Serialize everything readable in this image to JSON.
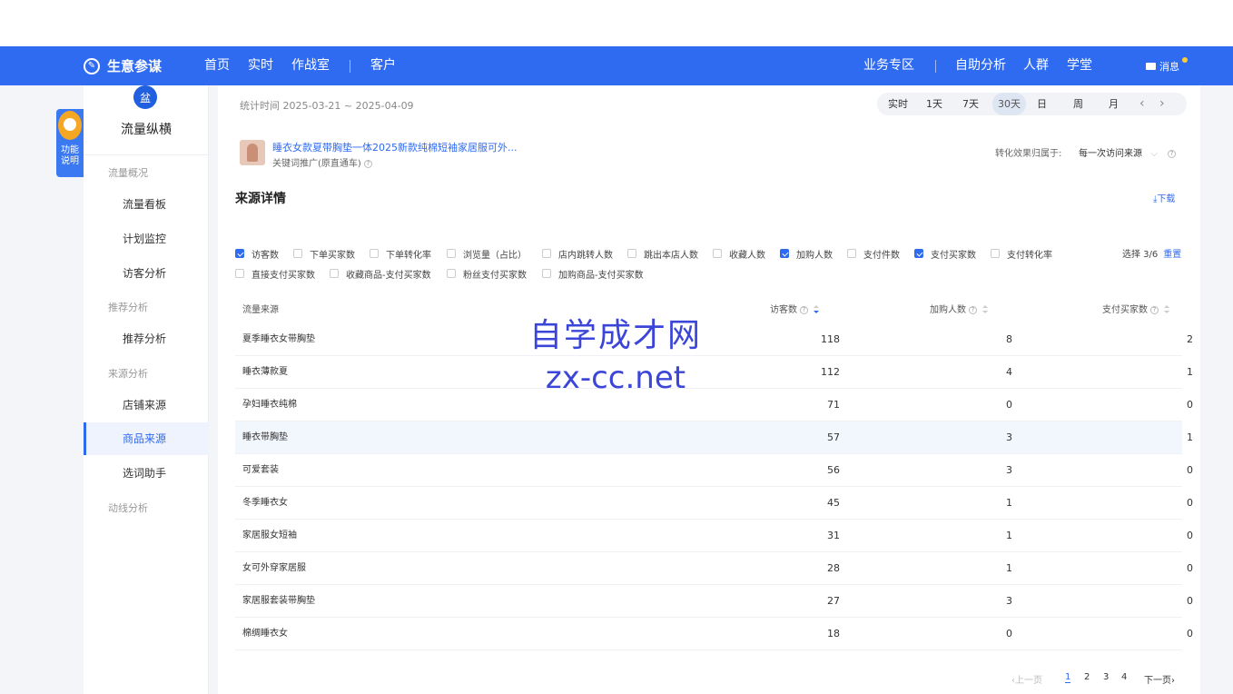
{
  "topnav": {
    "brand": "生意参谋",
    "left_items": [
      "首页",
      "实时",
      "作战室",
      "客户"
    ],
    "right_items": [
      "业务专区",
      "自助分析",
      "人群",
      "学堂"
    ],
    "messages": "消息"
  },
  "helper": {
    "label": "功能说明"
  },
  "sidebar": {
    "icon_char": "盆",
    "title": "流量纵横",
    "groups": [
      {
        "label": "流量概况",
        "items": [
          "流量看板",
          "计划监控",
          "访客分析"
        ]
      },
      {
        "label": "推荐分析",
        "items": [
          "推荐分析"
        ]
      },
      {
        "label": "来源分析",
        "items": [
          "店铺来源",
          "商品来源",
          "选词助手"
        ]
      },
      {
        "label": "动线分析",
        "items": []
      }
    ],
    "active_item": "商品来源"
  },
  "header": {
    "stat_time": "统计时间 2025-03-21 ~ 2025-04-09",
    "periods": [
      "实时",
      "1天",
      "7天",
      "30天",
      "日",
      "周",
      "月"
    ],
    "active_period": "30天",
    "prev": "‹",
    "next": "›"
  },
  "product": {
    "title": "睡衣女款夏带胸垫一体2025新款纯棉短袖家居服可外...",
    "subtitle": "关键词推广(原直通车)"
  },
  "attribution": {
    "label": "转化效果归属于:",
    "value": "每一次访问来源"
  },
  "section": {
    "title": "来源详情",
    "download": "下载"
  },
  "metrics": {
    "row1": [
      {
        "label": "访客数",
        "checked": true
      },
      {
        "label": "下单买家数",
        "checked": false
      },
      {
        "label": "下单转化率",
        "checked": false
      },
      {
        "label": "浏览量（占比）",
        "checked": false
      },
      {
        "label": "店内跳转人数",
        "checked": false
      },
      {
        "label": "跳出本店人数",
        "checked": false
      },
      {
        "label": "收藏人数",
        "checked": false
      },
      {
        "label": "加购人数",
        "checked": true
      },
      {
        "label": "支付件数",
        "checked": false
      },
      {
        "label": "支付买家数",
        "checked": true
      },
      {
        "label": "支付转化率",
        "checked": false
      }
    ],
    "row2": [
      {
        "label": "直接支付买家数",
        "checked": false
      },
      {
        "label": "收藏商品-支付买家数",
        "checked": false
      },
      {
        "label": "粉丝支付买家数",
        "checked": false
      },
      {
        "label": "加购商品-支付买家数",
        "checked": false
      }
    ],
    "selected": "选择 3/6",
    "reset": "重置"
  },
  "table": {
    "headers": [
      "流量来源",
      "访客数",
      "加购人数",
      "支付买家数"
    ],
    "rows": [
      {
        "source": "夏季睡衣女带胸垫",
        "visitors": "118",
        "cart": "8",
        "buyers": "2"
      },
      {
        "source": "睡衣薄款夏",
        "visitors": "112",
        "cart": "4",
        "buyers": "1"
      },
      {
        "source": "孕妇睡衣纯棉",
        "visitors": "71",
        "cart": "0",
        "buyers": "0"
      },
      {
        "source": "睡衣带胸垫",
        "visitors": "57",
        "cart": "3",
        "buyers": "1"
      },
      {
        "source": "可爱套装",
        "visitors": "56",
        "cart": "3",
        "buyers": "0"
      },
      {
        "source": "冬季睡衣女",
        "visitors": "45",
        "cart": "1",
        "buyers": "0"
      },
      {
        "source": "家居服女短袖",
        "visitors": "31",
        "cart": "1",
        "buyers": "0"
      },
      {
        "source": "女可外穿家居服",
        "visitors": "28",
        "cart": "1",
        "buyers": "0"
      },
      {
        "source": "家居服套装带胸垫",
        "visitors": "27",
        "cart": "3",
        "buyers": "0"
      },
      {
        "source": "棉绸睡衣女",
        "visitors": "18",
        "cart": "0",
        "buyers": "0"
      }
    ],
    "highlighted_row": 3
  },
  "pagination": {
    "prev": "‹上一页",
    "pages": [
      "1",
      "2",
      "3",
      "4"
    ],
    "current": "1",
    "next": "下一页›"
  },
  "watermark": {
    "line1": "自学成才网",
    "line2": "zx-cc.net"
  },
  "colors": {
    "brand_blue": "#2f6bf0",
    "watermark": "#3b46d9"
  }
}
